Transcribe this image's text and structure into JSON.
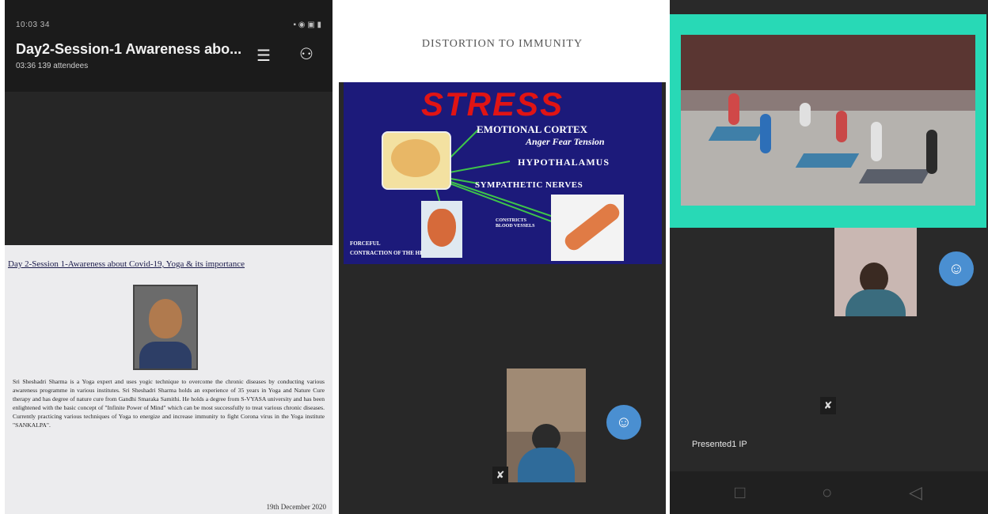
{
  "panel_left": {
    "status_time": "10:03  34",
    "status_icons": "▪ ◉ ▣ ▮",
    "meeting_title": "Day2-Session-1 Awareness abo...",
    "meeting_subtitle": "03:36  139 attendees",
    "doc_heading": "Day 2-Session 1-Awareness about Covid-19, Yoga & its importance",
    "bio_text": "Sri Sheshadri Sharma is a Yoga expert and uses yogic technique to overcome the chronic diseases by conducting various awareness programme in various institutes. Sri Sheshadri Sharma holds an experience of 35 years in Yoga and Nature Cure therapy and has degree of nature cure from Gandhi Smaraka Samithi. He holds a degree from S-VYASA university and has been enlightened with the basic concept of \"Infinite Power of Mind\" which can be most successfully to treat various chronic diseases. Currently practicing various techniques of Yoga to energize and increase immunity to fight Corona virus in the Yoga institute \"SANKALPA\".",
    "doc_date": "19th December 2020"
  },
  "panel_middle": {
    "slide_title": "DISTORTION TO IMMUNITY",
    "stress_label": "STRESS",
    "emotional_cortex": "EMOTIONAL CORTEX",
    "emotions": "Anger Fear Tension",
    "hypothalamus": "HYPOTHALAMUS",
    "sympathetic": "SYMPATHETIC NERVES",
    "constricts": "CONSTRICTS BLOOD VESSELS",
    "forceful_1": "FORCEFUL",
    "forceful_2": "CONTRACTION OF THE HEART"
  },
  "panel_right": {
    "presenter_label": "Presented1 IP"
  },
  "icons": {
    "mic_off": "✘",
    "avatar": "☺",
    "chat": "☰",
    "people": "⚇",
    "nav_recent": "□",
    "nav_home": "○",
    "nav_back": "◁"
  },
  "colors": {
    "slide_bg": "#1c1a7a",
    "stress_red": "#e01414",
    "frame_teal": "#28d9b6",
    "button_blue": "#4a8fd1"
  }
}
